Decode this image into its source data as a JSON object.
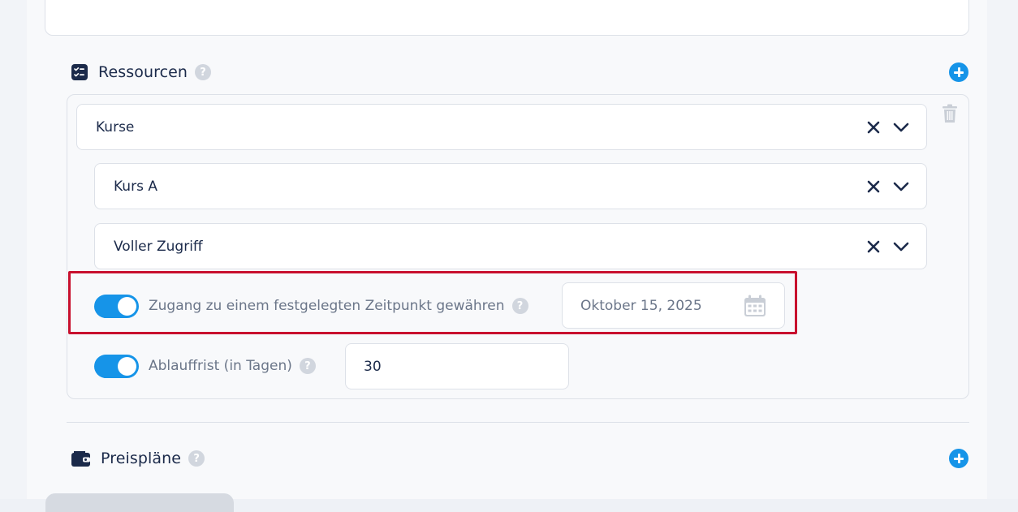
{
  "sections": {
    "resources": {
      "title": "Ressourcen",
      "help": "?"
    },
    "pricing": {
      "title": "Preispläne",
      "help": "?"
    }
  },
  "resource_item": {
    "type_select": {
      "value": "Kurse"
    },
    "course_select": {
      "value": "Kurs A"
    },
    "access_select": {
      "value": "Voller Zugriff"
    }
  },
  "fixed_time_access": {
    "enabled": true,
    "label": "Zugang zu einem festgelegten Zeitpunkt gewähren",
    "help": "?",
    "date_placeholder": "Oktober 15, 2025"
  },
  "expiry": {
    "enabled": true,
    "label": "Ablauffrist (in Tagen)",
    "help": "?",
    "value": "30"
  },
  "colors": {
    "accent": "#1694e8",
    "text": "#1b2a4a",
    "muted": "#6b7689",
    "highlight": "#c8102e"
  }
}
